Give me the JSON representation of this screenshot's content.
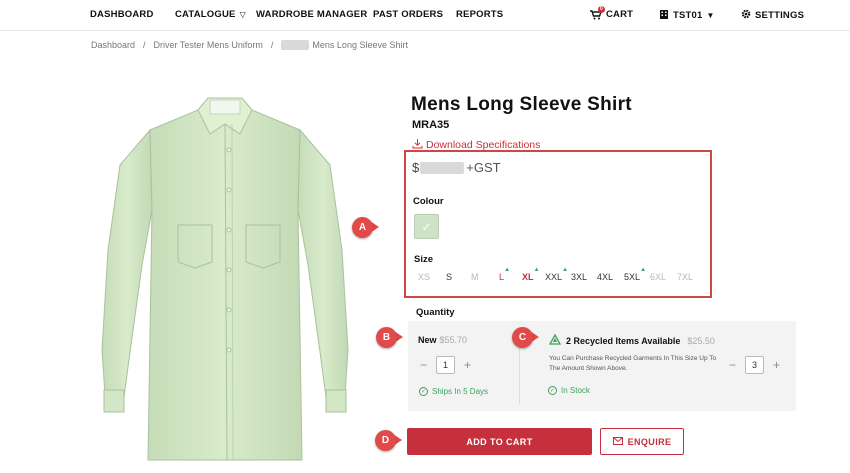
{
  "nav": {
    "dashboard": "DASHBOARD",
    "catalogue": "CATALOGUE",
    "wardrobe_manager": "WARDROBE MANAGER",
    "past_orders": "PAST ORDERS",
    "reports": "REPORTS",
    "cart": "CART",
    "cart_count": "0",
    "account": "TST01",
    "settings": "SETTINGS"
  },
  "breadcrumb": {
    "items": [
      "Dashboard",
      "Driver Tester Mens Uniform",
      "Mens Long Sleeve Shirt"
    ],
    "separator": "/"
  },
  "product": {
    "title": "Mens Long Sleeve Shirt",
    "sku": "MRA35",
    "download_label": "Download Specifications",
    "price_prefix": "$",
    "price_suffix": "+GST",
    "colour_label": "Colour",
    "colour_swatch": "#cfe3c9",
    "size_label": "Size",
    "sizes": [
      {
        "label": "XS",
        "state": "disabled"
      },
      {
        "label": "S",
        "state": "available"
      },
      {
        "label": "M",
        "state": "disabled"
      },
      {
        "label": "L",
        "state": "recycled"
      },
      {
        "label": "XL",
        "state": "selected-recycled"
      },
      {
        "label": "XXL",
        "state": "available-recycled"
      },
      {
        "label": "3XL",
        "state": "available"
      },
      {
        "label": "4XL",
        "state": "available"
      },
      {
        "label": "5XL",
        "state": "available-recycled"
      },
      {
        "label": "6XL",
        "state": "disabled"
      },
      {
        "label": "7XL",
        "state": "disabled"
      }
    ]
  },
  "quantity": {
    "label": "Quantity",
    "new_label": "New",
    "new_price": "$55.70",
    "new_qty": "1",
    "new_status": "Ships In 5 Days",
    "recycled_label": "2 Recycled Items Available",
    "recycled_price": "$25.50",
    "recycled_desc": "You Can Purchase Recycled Garments In This Size Up To The Amount Shown Above.",
    "recycled_qty": "3",
    "recycled_status": "In Stock",
    "minus": "−",
    "plus": "+"
  },
  "actions": {
    "add_to_cart": "ADD TO CART",
    "enquire": "ENQUIRE"
  },
  "callouts": {
    "a": "A",
    "b": "B",
    "c": "C",
    "d": "D"
  },
  "colors": {
    "brand_red": "#c5303c",
    "callout_red": "#e24a4a",
    "success_green": "#3aa35a"
  }
}
